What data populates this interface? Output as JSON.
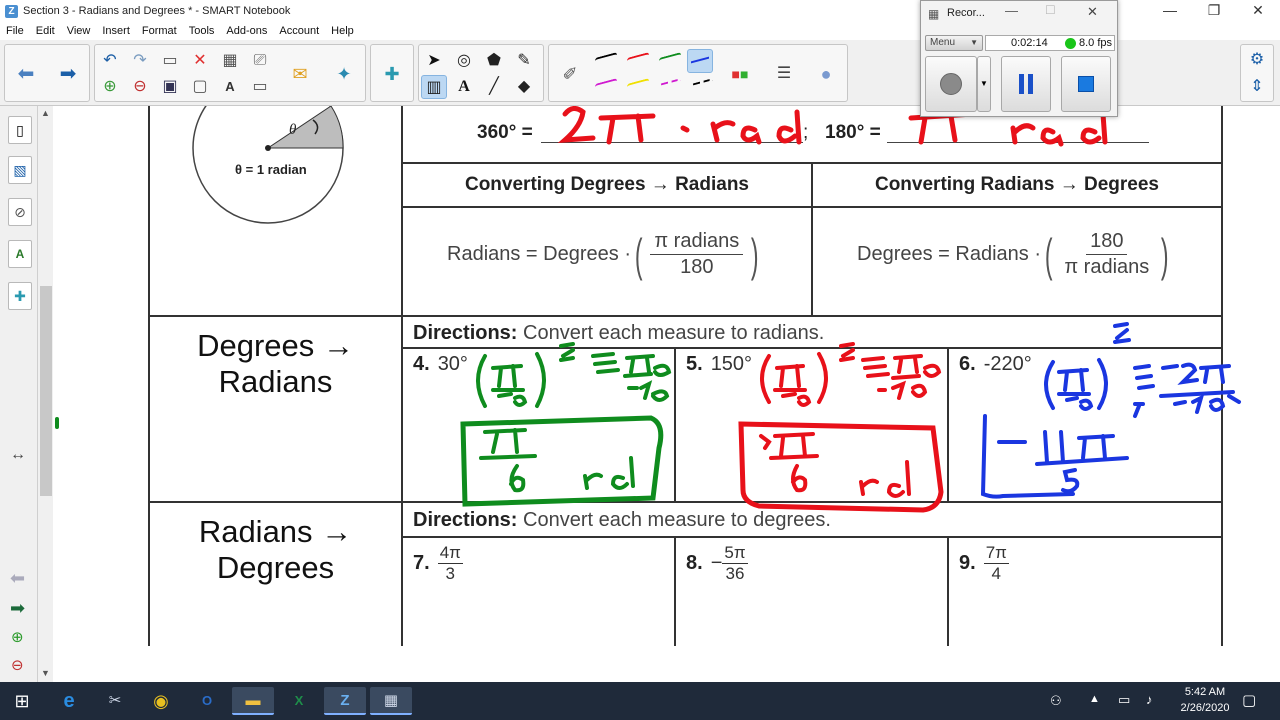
{
  "window": {
    "title": "Section 3 - Radians and Degrees * - SMART Notebook",
    "minimize": "—",
    "maximize": "❐",
    "close": "✕"
  },
  "menu": [
    "File",
    "Edit",
    "View",
    "Insert",
    "Format",
    "Tools",
    "Add-ons",
    "Account",
    "Help"
  ],
  "recorder": {
    "title": "Recor...",
    "menu_label": "Menu",
    "elapsed": "0:02:14",
    "fps": "8.0 fps"
  },
  "worksheet": {
    "circle_theta": "θ",
    "circle_caption": "θ = 1 radian",
    "eq1_lhs": "360° =",
    "eq1_sep": ";",
    "eq2_lhs": "180° =",
    "header_deg_to_rad": "Converting Degrees → Radians",
    "header_rad_to_deg": "Converting Radians → Degrees",
    "formula1": {
      "lhs": "Radians = Degrees ·",
      "num": "π radians",
      "den": "180"
    },
    "formula2": {
      "lhs": "Degrees = Radians ·",
      "num": "180",
      "den": "π radians"
    },
    "section1": {
      "label_line1": "Degrees →",
      "label_line2": "Radians",
      "directions_bold": "Directions:",
      "directions_text": " Convert each measure to radians.",
      "problems": [
        {
          "num": "4.",
          "value": "30°"
        },
        {
          "num": "5.",
          "value": "150°"
        },
        {
          "num": "6.",
          "value": "-220°"
        }
      ]
    },
    "section2": {
      "label_line1": "Radians →",
      "label_line2": "Degrees",
      "directions_bold": "Directions:",
      "directions_text": " Convert each measure to degrees.",
      "problems": [
        {
          "num": "7.",
          "sign": "",
          "frac_num": "4π",
          "frac_den": "3"
        },
        {
          "num": "8.",
          "sign": "−",
          "frac_num": "5π",
          "frac_den": "36"
        },
        {
          "num": "9.",
          "sign": "",
          "frac_num": "7π",
          "frac_den": "4"
        }
      ]
    }
  },
  "ink_colors": {
    "red": "#e8111a",
    "green": "#0f8c1e",
    "blue": "#1a36e0",
    "black": "#000000",
    "magenta": "#d01ad0",
    "yellow": "#f0e000"
  },
  "taskbar": {
    "time": "5:42 AM",
    "date": "2/26/2020"
  }
}
